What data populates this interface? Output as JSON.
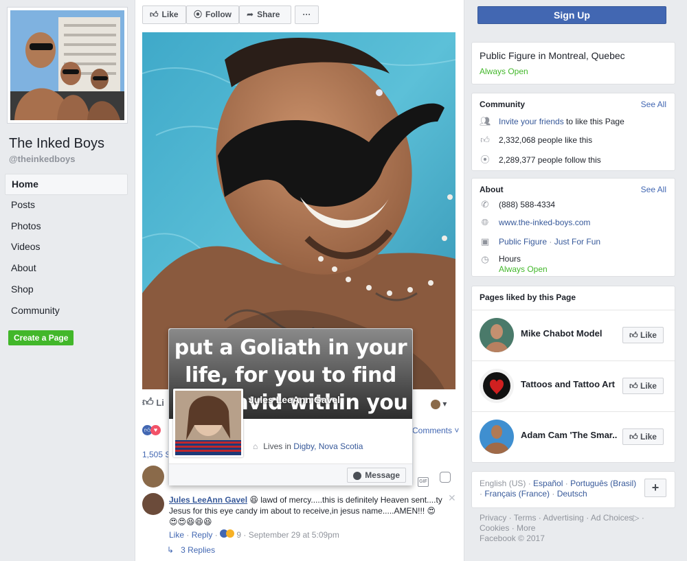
{
  "page": {
    "name": "The Inked Boys",
    "handle": "@theinkedboys"
  },
  "nav": {
    "items": [
      "Home",
      "Posts",
      "Photos",
      "Videos",
      "About",
      "Shop",
      "Community"
    ],
    "active": "Home",
    "create_page": "Create a Page"
  },
  "toolbar": {
    "like": "Like",
    "follow": "Follow",
    "share": "Share",
    "more": "···",
    "signup": "Sign Up"
  },
  "post": {
    "like_label": "Li",
    "reaction_count": "1,505 S",
    "comments_link": "Comments ˅"
  },
  "hovercard": {
    "cover_text": "put a Goliath in your life, for you to find the David within you",
    "name": "Jules LeeAnn Gavel",
    "lives_prefix": "Lives in",
    "lives_city": "Digby, Nova Scotia",
    "message_button": "Message"
  },
  "comment": {
    "author": "Jules LeeAnn Gavel",
    "text_line1": " lawd of mercy.....this is definitely Heaven sent....ty",
    "text_line2": "Jesus for this eye candy im about to receive,in jesus name.....AMEN!!!",
    "emoji_line": "😍😍😆😆😆",
    "like": "Like",
    "reply": "Reply",
    "reaction_count": "9",
    "timestamp": "September 29 at 5:09pm",
    "replies": "3 Replies"
  },
  "info": {
    "category": "Public Figure in Montreal, Quebec",
    "status": "Always Open"
  },
  "community": {
    "title": "Community",
    "see_all": "See All",
    "invite_link": "Invite your friends",
    "invite_suffix": " to like this Page",
    "likes": "2,332,068 people like this",
    "follows": "2,289,377 people follow this"
  },
  "about": {
    "title": "About",
    "see_all": "See All",
    "phone": "(888) 588-4334",
    "website": "www.the-inked-boys.com",
    "category_1": "Public Figure",
    "category_sep": " · ",
    "category_2": "Just For Fun",
    "hours_label": "Hours",
    "hours_value": "Always Open"
  },
  "pages_liked": {
    "title": "Pages liked by this Page",
    "like_label": "Like",
    "items": [
      "Mike Chabot Model",
      "Tattoos and Tattoo Art",
      "Adam Cam 'The Smar..."
    ]
  },
  "languages": {
    "current": "English (US)",
    "others": [
      "Español",
      "Português (Brasil)",
      "Français (France)",
      "Deutsch"
    ],
    "plus": "+"
  },
  "footer": {
    "links": [
      "Privacy",
      "Terms",
      "Advertising",
      "Ad Choices",
      "Cookies",
      "More"
    ],
    "copyright": "Facebook © 2017"
  },
  "colors": {
    "brand_blue": "#4267b2",
    "link_blue": "#365899",
    "green": "#42b72a",
    "background": "#e9ebee"
  }
}
